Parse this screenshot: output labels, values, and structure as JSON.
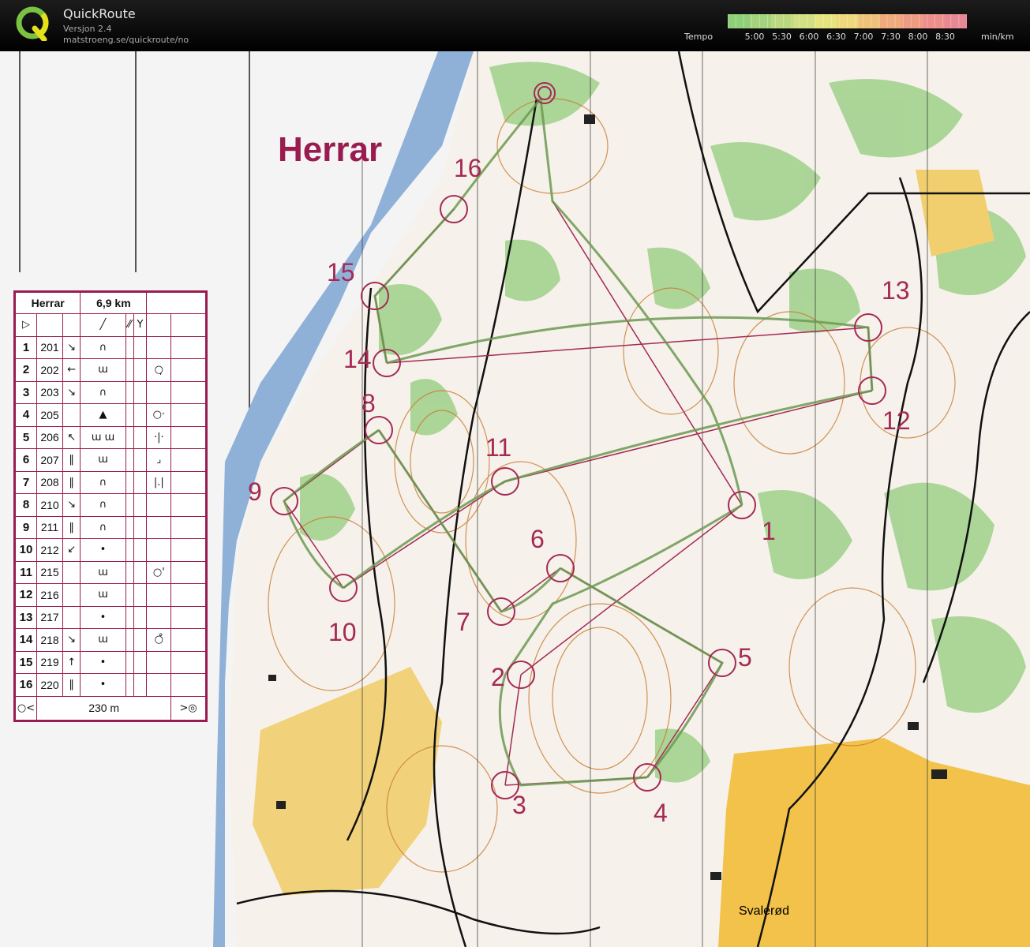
{
  "app": {
    "title": "QuickRoute",
    "version": "Versjon 2.4",
    "url": "matstroeng.se/quickroute/no",
    "logo_letter": "Q"
  },
  "tempo": {
    "label": "Tempo",
    "unit": "min/km",
    "ticks": [
      "5:00",
      "5:30",
      "6:00",
      "6:30",
      "7:00",
      "7:30",
      "8:00",
      "8:30"
    ],
    "colors": [
      "#8fcf7a",
      "#a4d27d",
      "#bcd87e",
      "#d2df82",
      "#e6e47f",
      "#eed77c",
      "#efc17a",
      "#efab7c",
      "#ee9b83",
      "#ec8e8c",
      "#e88894"
    ]
  },
  "map": {
    "course_title": "Herrar",
    "place_name": "Svalerød",
    "course_color": "#a42a55",
    "route_color": "#6c9a52",
    "controls": [
      {
        "label": "1"
      },
      {
        "label": "2"
      },
      {
        "label": "3"
      },
      {
        "label": "4"
      },
      {
        "label": "5"
      },
      {
        "label": "6"
      },
      {
        "label": "7"
      },
      {
        "label": "8"
      },
      {
        "label": "9"
      },
      {
        "label": "10"
      },
      {
        "label": "11"
      },
      {
        "label": "12"
      },
      {
        "label": "13"
      },
      {
        "label": "14"
      },
      {
        "label": "15"
      },
      {
        "label": "16"
      }
    ]
  },
  "description_sheet": {
    "event": "Herrar",
    "length": "6,9 km",
    "finish_distance": "230 m",
    "rows": [
      {
        "num": "1",
        "code": "201",
        "dir": "↘",
        "feature": "∩",
        "extra": ""
      },
      {
        "num": "2",
        "code": "202",
        "dir": "←",
        "feature": "ɯ",
        "extra": "○̦"
      },
      {
        "num": "3",
        "code": "203",
        "dir": "↘",
        "feature": "∩",
        "extra": ""
      },
      {
        "num": "4",
        "code": "205",
        "dir": "",
        "feature": "▲",
        "extra": "○·"
      },
      {
        "num": "5",
        "code": "206",
        "dir": "↖",
        "feature": "ɯ ɯ",
        "extra": "·|·"
      },
      {
        "num": "6",
        "code": "207",
        "dir": "‖",
        "feature": "ɯ",
        "extra": "⌟"
      },
      {
        "num": "7",
        "code": "208",
        "dir": "‖",
        "feature": "∩",
        "extra": "|.|"
      },
      {
        "num": "8",
        "code": "210",
        "dir": "↘",
        "feature": "∩",
        "extra": ""
      },
      {
        "num": "9",
        "code": "211",
        "dir": "‖",
        "feature": "∩",
        "extra": ""
      },
      {
        "num": "10",
        "code": "212",
        "dir": "↙",
        "feature": "•",
        "extra": ""
      },
      {
        "num": "11",
        "code": "215",
        "dir": "",
        "feature": "ɯ",
        "extra": "○'"
      },
      {
        "num": "12",
        "code": "216",
        "dir": "",
        "feature": "ɯ",
        "extra": ""
      },
      {
        "num": "13",
        "code": "217",
        "dir": "",
        "feature": "•",
        "extra": ""
      },
      {
        "num": "14",
        "code": "218",
        "dir": "↘",
        "feature": "ɯ",
        "extra": "○̊"
      },
      {
        "num": "15",
        "code": "219",
        "dir": "↑",
        "feature": "•",
        "extra": ""
      },
      {
        "num": "16",
        "code": "220",
        "dir": "‖",
        "feature": "•",
        "extra": ""
      }
    ]
  }
}
